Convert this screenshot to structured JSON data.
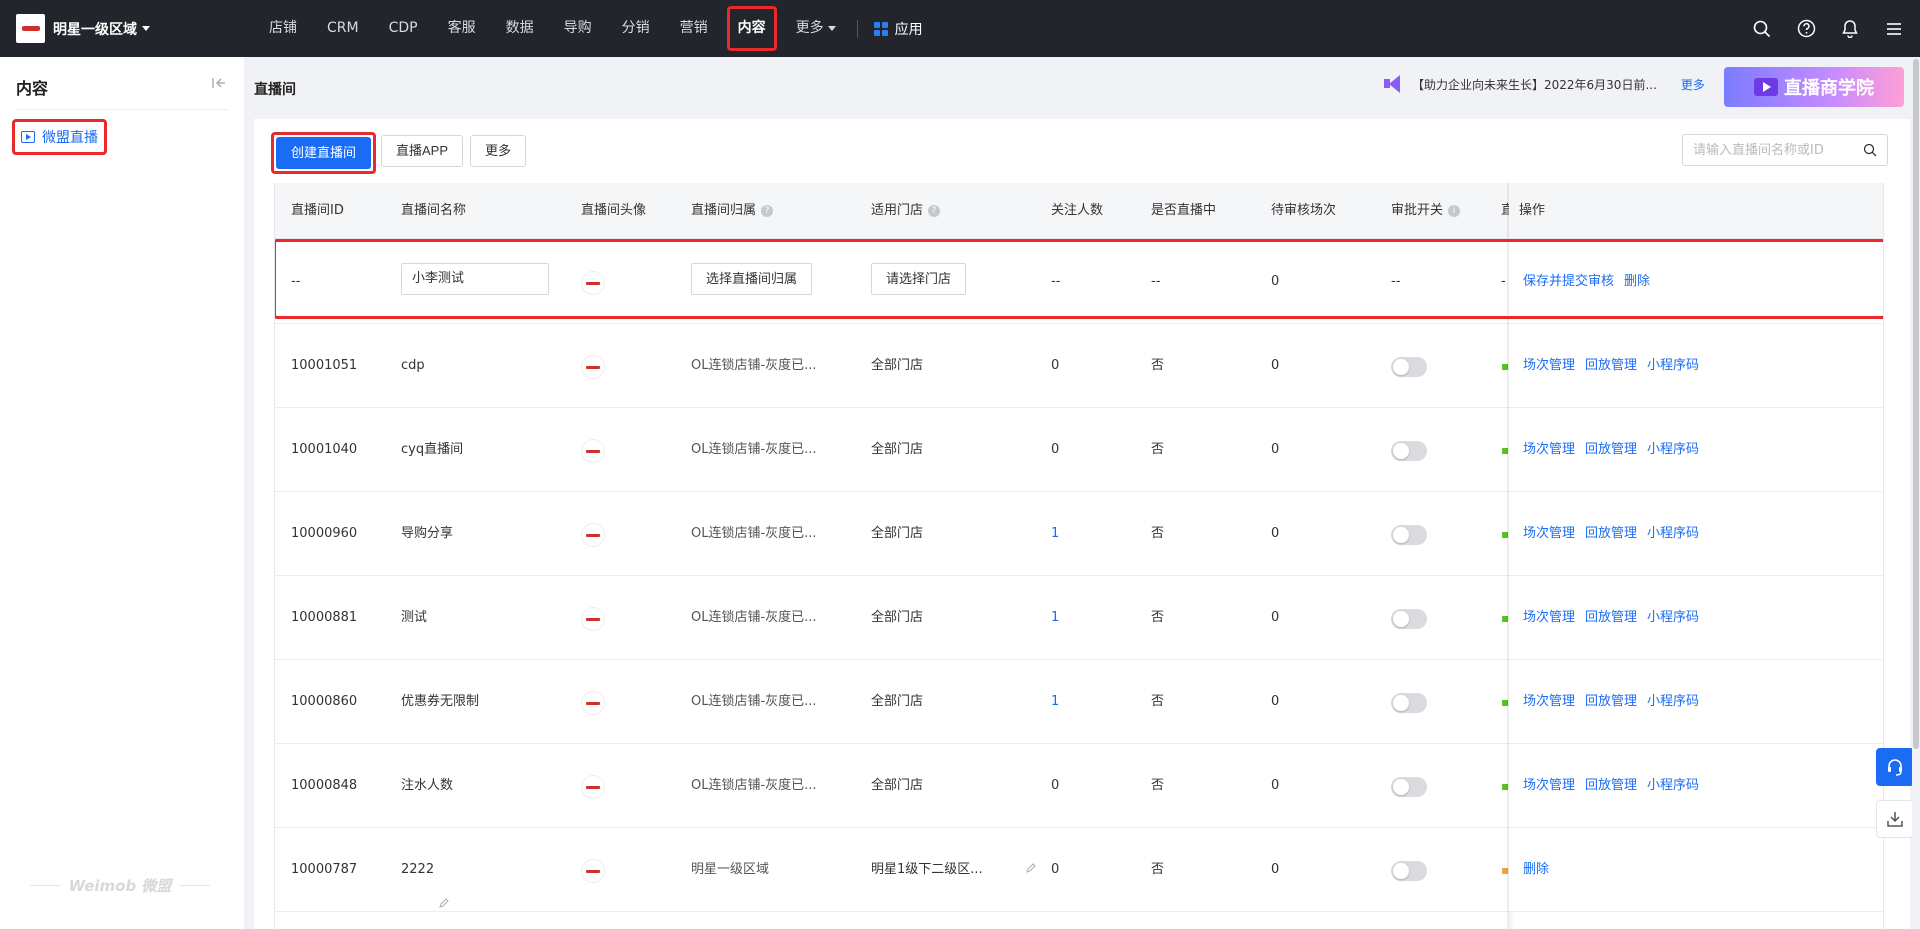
{
  "topnav": {
    "org_name": "明星一级区域",
    "items": [
      "店铺",
      "CRM",
      "CDP",
      "客服",
      "数据",
      "导购",
      "分销",
      "营销",
      "内容"
    ],
    "active_item": "内容",
    "more_label": "更多",
    "apps_label": "应用"
  },
  "sidebar": {
    "title": "内容",
    "item_label": "微盟直播",
    "footer_brand": "Weimob 微盟"
  },
  "header": {
    "title": "直播间",
    "notice_text": "【助力企业向未来生长】2022年6月30日前...",
    "notice_more": "更多",
    "banner_text": "直播商学院"
  },
  "toolbar": {
    "create_label": "创建直播间",
    "app_label": "直播APP",
    "more_label": "更多",
    "search_placeholder": "请输入直播间名称或ID"
  },
  "table": {
    "columns": {
      "id": "直播间ID",
      "name": "直播间名称",
      "avatar": "直播间头像",
      "belong": "直播间归属",
      "store": "适用门店",
      "followers": "关注人数",
      "live": "是否直播中",
      "pending": "待审核场次",
      "approval": "审批开关",
      "partial": "直",
      "ops": "操作"
    },
    "new_row": {
      "id": "--",
      "name_value": "小李测试",
      "belong_button": "选择直播间归属",
      "store_button": "请选择门店",
      "followers": "--",
      "live": "--",
      "pending": "0",
      "approval": "--",
      "partial": "-",
      "actions": [
        "保存并提交审核",
        "删除"
      ]
    },
    "rows": [
      {
        "id": "10001051",
        "name": "cdp",
        "belong": "OL连锁店铺-灰度已...",
        "store": "全部门店",
        "followers": "0",
        "live": "否",
        "pending": "0",
        "actions": [
          "场次管理",
          "回放管理",
          "小程序码"
        ]
      },
      {
        "id": "10001040",
        "name": "cyq直播间",
        "belong": "OL连锁店铺-灰度已...",
        "store": "全部门店",
        "followers": "0",
        "live": "否",
        "pending": "0",
        "actions": [
          "场次管理",
          "回放管理",
          "小程序码"
        ]
      },
      {
        "id": "10000960",
        "name": "导购分享",
        "belong": "OL连锁店铺-灰度已...",
        "store": "全部门店",
        "followers": "1",
        "live": "否",
        "pending": "0",
        "actions": [
          "场次管理",
          "回放管理",
          "小程序码"
        ]
      },
      {
        "id": "10000881",
        "name": "测试",
        "belong": "OL连锁店铺-灰度已...",
        "store": "全部门店",
        "followers": "1",
        "live": "否",
        "pending": "0",
        "actions": [
          "场次管理",
          "回放管理",
          "小程序码"
        ]
      },
      {
        "id": "10000860",
        "name": "优惠券无限制",
        "belong": "OL连锁店铺-灰度已...",
        "store": "全部门店",
        "followers": "1",
        "live": "否",
        "pending": "0",
        "actions": [
          "场次管理",
          "回放管理",
          "小程序码"
        ]
      },
      {
        "id": "10000848",
        "name": "注水人数",
        "belong": "OL连锁店铺-灰度已...",
        "store": "全部门店",
        "followers": "0",
        "live": "否",
        "pending": "0",
        "actions": [
          "场次管理",
          "回放管理",
          "小程序码"
        ]
      },
      {
        "id": "10000787",
        "name": "2222",
        "belong": "明星一级区域",
        "store": "明星1级下二级区...",
        "followers": "0",
        "live": "否",
        "pending": "0",
        "actions": [
          "删除"
        ]
      }
    ]
  },
  "colors": {
    "primary": "#1a6cf5",
    "highlight": "#e8292d",
    "nav_bg": "#22252b"
  }
}
